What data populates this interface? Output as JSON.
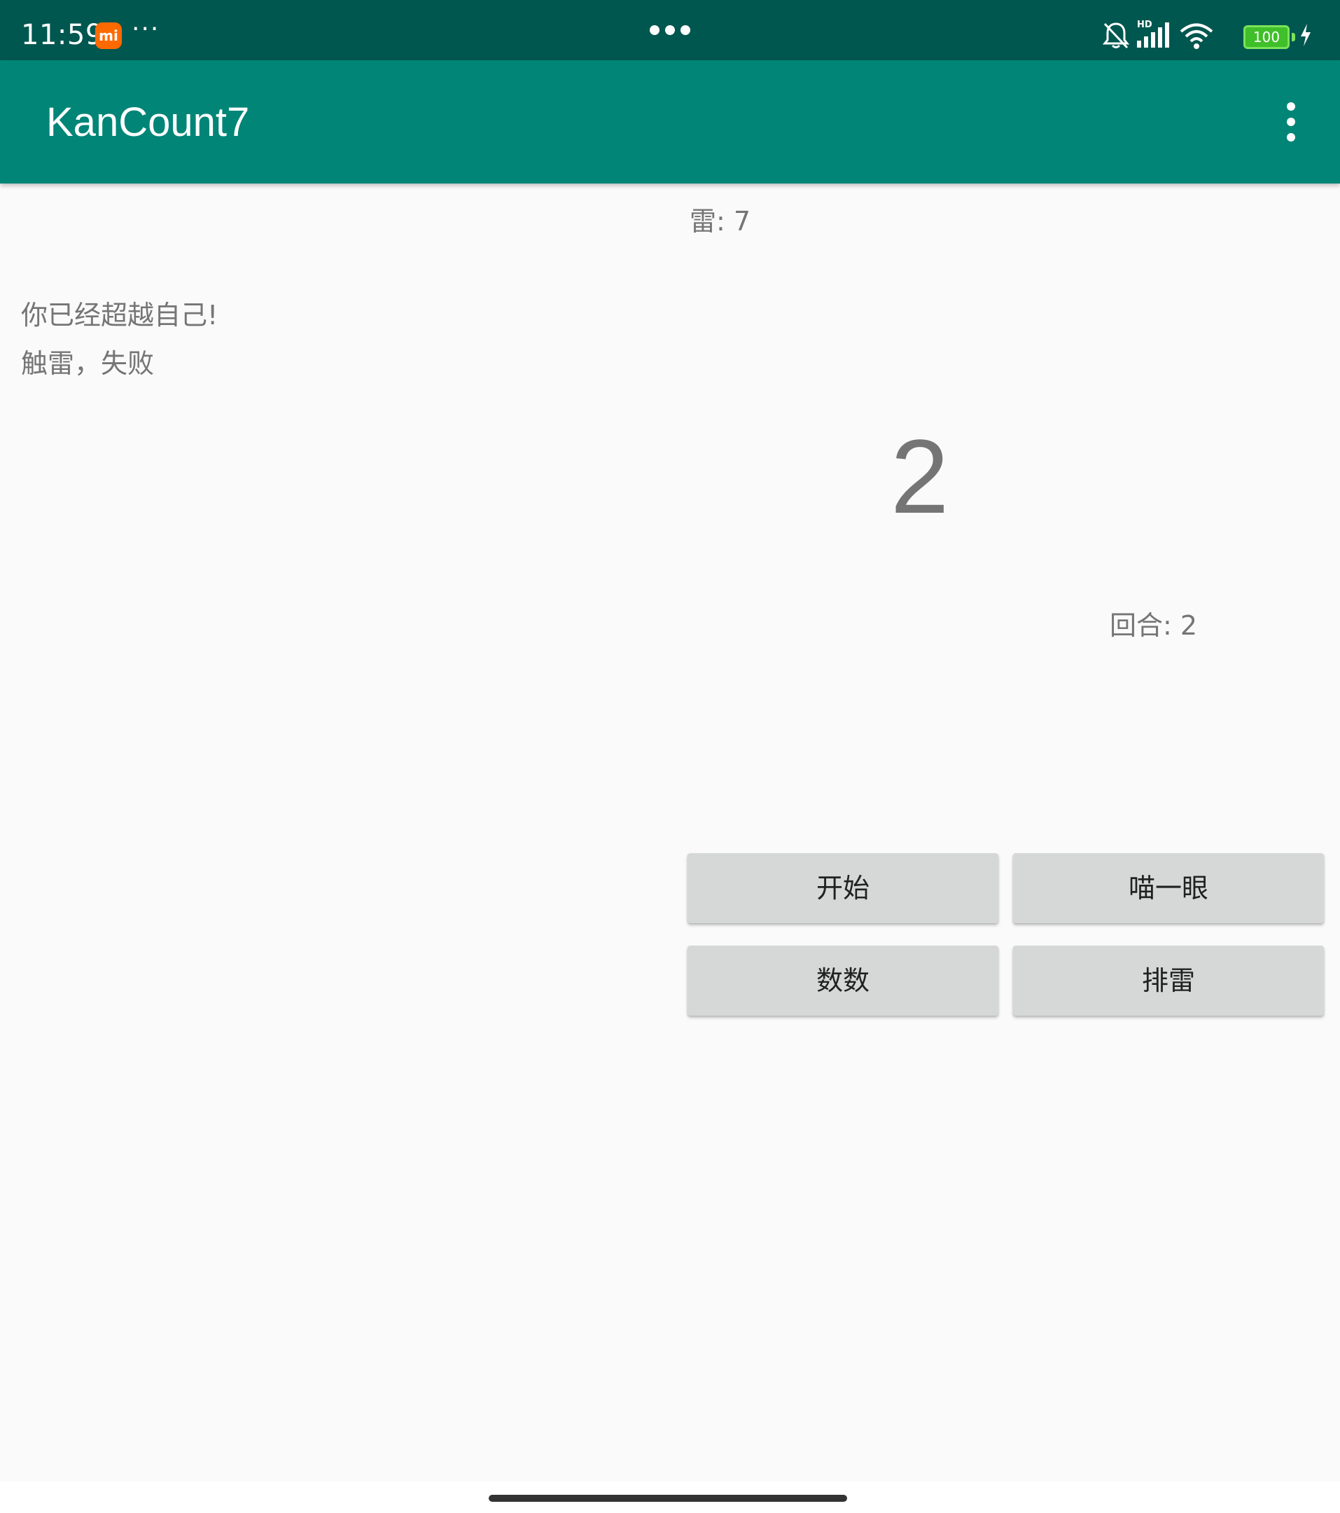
{
  "status_bar": {
    "time": "11:59",
    "mi_badge": "mi",
    "more": "···",
    "hd_label": "HD",
    "battery_level": "100",
    "icons": [
      "bell-off-icon",
      "signal-icon",
      "wifi-icon",
      "battery-icon",
      "charging-icon"
    ]
  },
  "app_bar": {
    "title": "KanCount7",
    "menu_icon": "more-vert-icon"
  },
  "game": {
    "mine_label": "雷: 7",
    "messages": [
      "你已经超越自己!",
      "触雷，失败"
    ],
    "current_number": "2",
    "round_label": "回合: 2"
  },
  "buttons": {
    "start": "开始",
    "peek": "喵一眼",
    "count": "数数",
    "sweep": "排雷"
  },
  "colors": {
    "status_bar": "#00574f",
    "app_bar": "#008577",
    "background": "#fafafa",
    "button": "#d6d7d7",
    "secondary_text": "#757575"
  }
}
